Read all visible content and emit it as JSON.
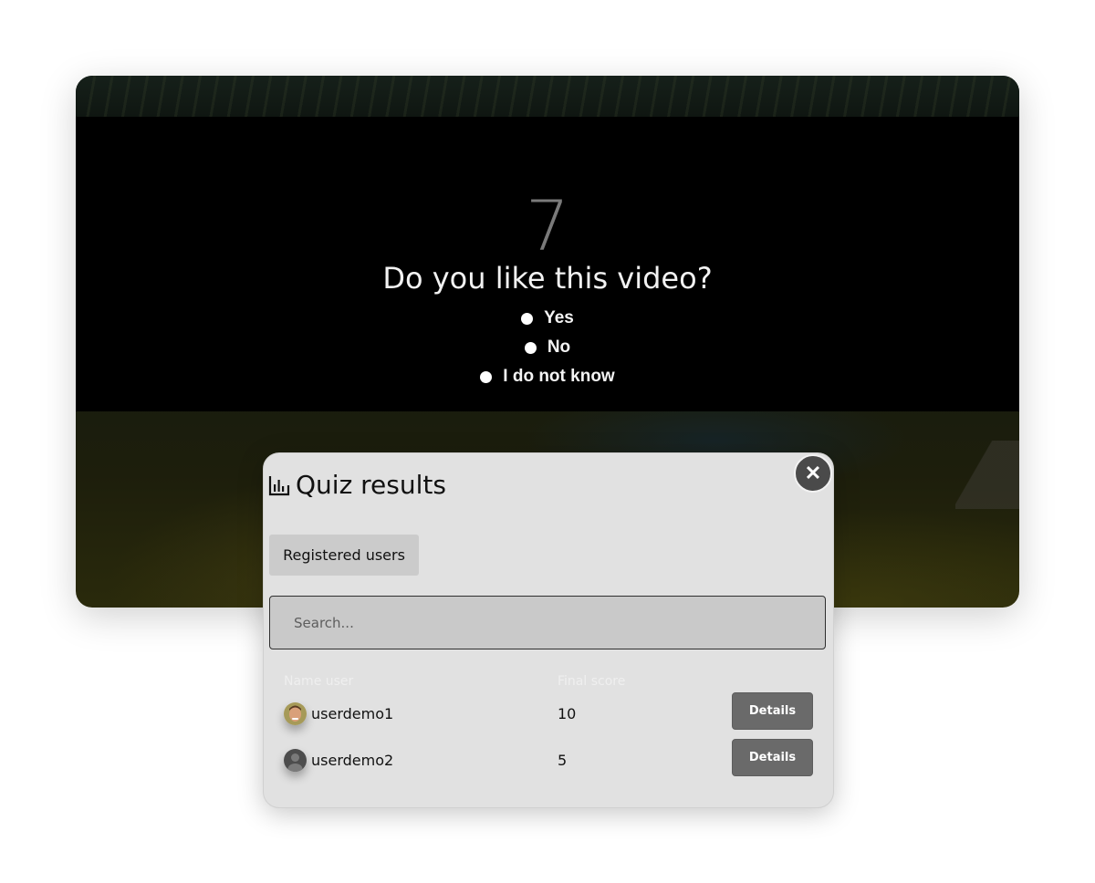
{
  "quiz": {
    "countdown": "7",
    "question": "Do you like this video?",
    "options": [
      "Yes",
      "No",
      "I do not know"
    ]
  },
  "modal": {
    "title": "Quiz results",
    "title_icon": "bar-chart-icon",
    "close_icon": "close-icon",
    "tab_label": "Registered users",
    "search_placeholder": "Search...",
    "columns": [
      "Name user",
      "Final score"
    ],
    "rows": [
      {
        "user": "userdemo1",
        "score": "10",
        "avatar": "photo-avatar",
        "action": "Details"
      },
      {
        "user": "userdemo2",
        "score": "5",
        "avatar": "default-avatar",
        "action": "Details"
      }
    ]
  }
}
